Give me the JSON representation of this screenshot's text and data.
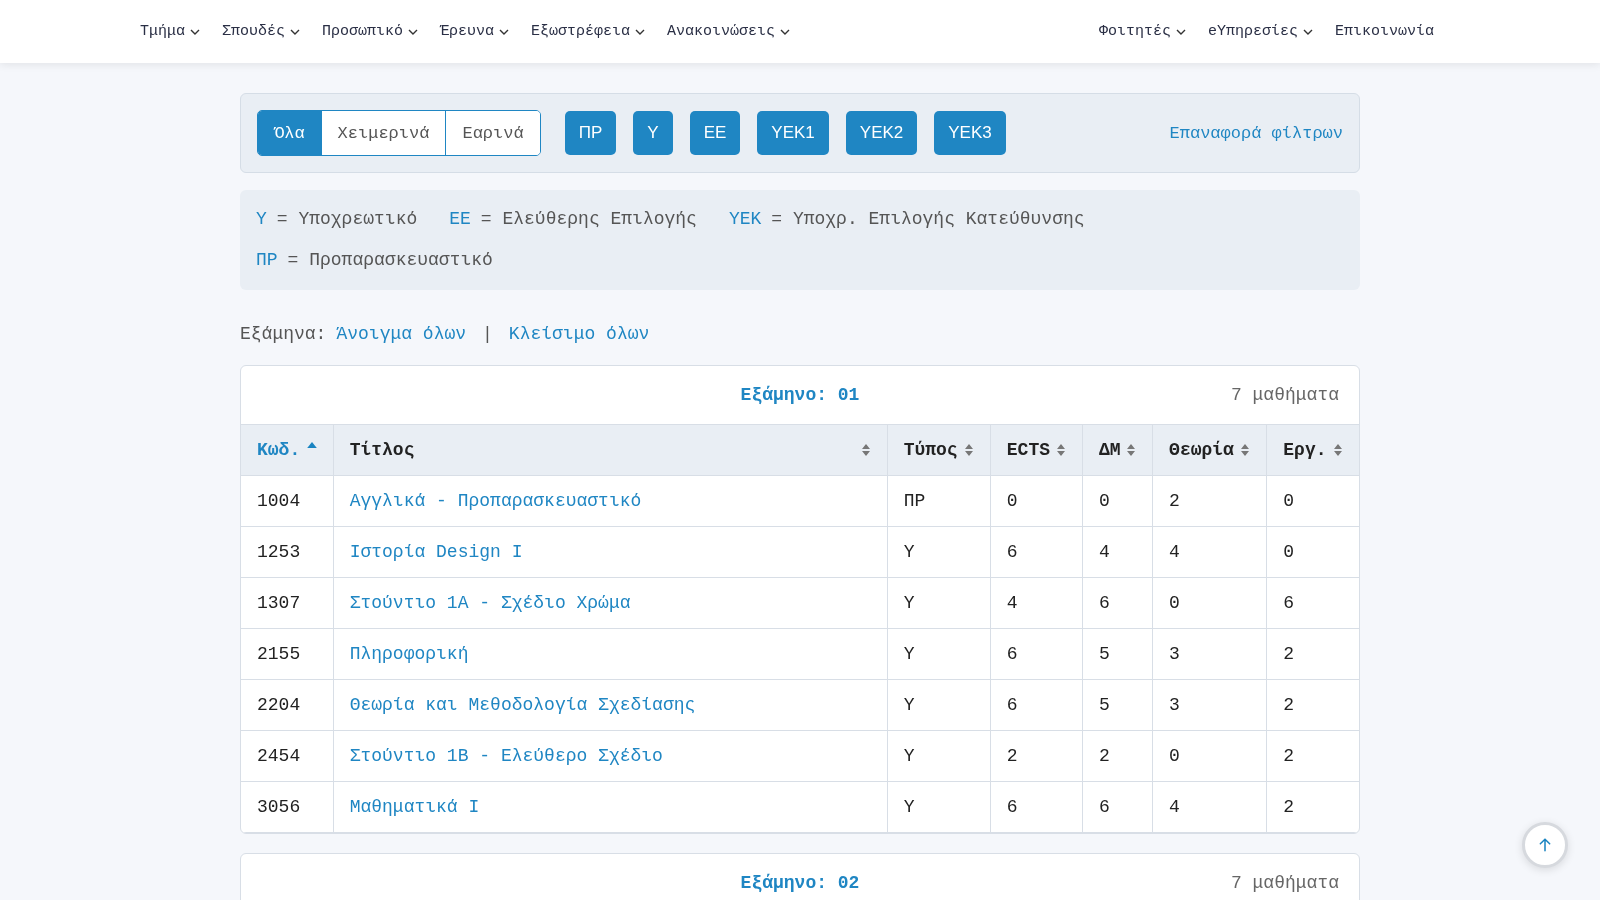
{
  "nav": {
    "left": [
      {
        "label": "Τμήμα",
        "dropdown": true
      },
      {
        "label": "Σπουδές",
        "dropdown": true
      },
      {
        "label": "Προσωπικό",
        "dropdown": true
      },
      {
        "label": "Έρευνα",
        "dropdown": true
      },
      {
        "label": "Εξωστρέφεια",
        "dropdown": true
      },
      {
        "label": "Ανακοινώσεις",
        "dropdown": true
      }
    ],
    "right": [
      {
        "label": "Φοιτητές",
        "dropdown": true
      },
      {
        "label": "eΥπηρεσίες",
        "dropdown": true
      },
      {
        "label": "Επικοινωνία",
        "dropdown": false
      }
    ]
  },
  "filters": {
    "seasons": [
      {
        "label": "Όλα",
        "selected": true
      },
      {
        "label": "Χειμερινά",
        "selected": false
      },
      {
        "label": "Εαρινά",
        "selected": false
      }
    ],
    "types": [
      "ΠΡ",
      "Υ",
      "ΕΕ",
      "ΥΕΚ1",
      "ΥΕΚ2",
      "ΥΕΚ3"
    ],
    "reset": "Επαναφορά φίλτρων"
  },
  "legend": [
    [
      {
        "key": "Υ",
        "text": "= Υποχρεωτικό"
      },
      {
        "key": "ΕΕ",
        "text": "= Ελεύθερης Επιλογής"
      },
      {
        "key": "ΥΕΚ",
        "text": "= Υποχρ. Επιλογής Κατεύθυνσης"
      }
    ],
    [
      {
        "key": "ΠΡ",
        "text": "= Προπαρασκευαστικό"
      }
    ]
  ],
  "semester_controls": {
    "label": "Εξάμηνα:",
    "open_all": "Άνοιγμα όλων",
    "separator": "|",
    "close_all": "Κλείσιμο όλων"
  },
  "semesters": [
    {
      "title": "Εξάμηνο: 01",
      "count": "7 μαθήματα",
      "columns": [
        {
          "label": "Κωδ.",
          "sorted": true
        },
        {
          "label": "Τίτλος",
          "sorted": false
        },
        {
          "label": "Τύπος",
          "sorted": false
        },
        {
          "label": "ECTS",
          "sorted": false
        },
        {
          "label": "ΔΜ",
          "sorted": false
        },
        {
          "label": "Θεωρία",
          "sorted": false
        },
        {
          "label": "Εργ.",
          "sorted": false
        }
      ],
      "rows": [
        [
          "1004",
          "Αγγλικά - Προπαρασκευαστικό",
          "ΠΡ",
          "0",
          "0",
          "2",
          "0"
        ],
        [
          "1253",
          "Ιστορία Design I",
          "Υ",
          "6",
          "4",
          "4",
          "0"
        ],
        [
          "1307",
          "Στούντιο 1Α - Σχέδιο Χρώμα",
          "Υ",
          "4",
          "6",
          "0",
          "6"
        ],
        [
          "2155",
          "Πληροφορική",
          "Υ",
          "6",
          "5",
          "3",
          "2"
        ],
        [
          "2204",
          "Θεωρία και Μεθοδολογία Σχεδίασης",
          "Υ",
          "6",
          "5",
          "3",
          "2"
        ],
        [
          "2454",
          "Στούντιο 1Β - Ελεύθερο Σχέδιο",
          "Υ",
          "2",
          "2",
          "0",
          "2"
        ],
        [
          "3056",
          "Μαθηματικά Ι",
          "Υ",
          "6",
          "6",
          "4",
          "2"
        ]
      ]
    },
    {
      "title": "Εξάμηνο: 02",
      "count": "7 μαθήματα"
    }
  ]
}
